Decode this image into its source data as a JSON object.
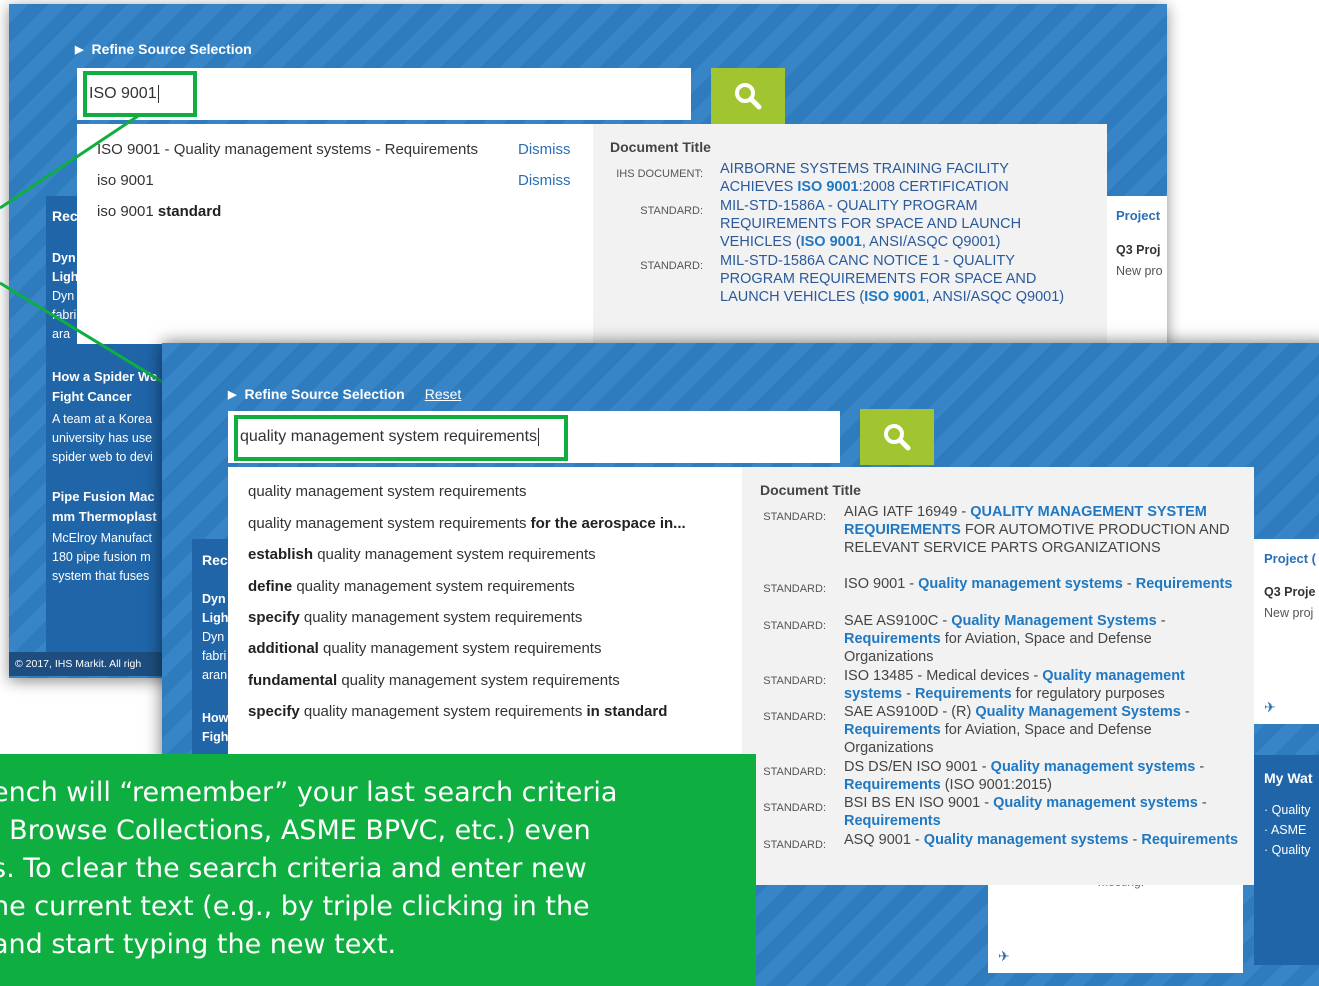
{
  "panel1": {
    "refine_label": "Refine Source Selection",
    "search_value": "ISO 9001",
    "suggestions": [
      {
        "text": "ISO 9001 - Quality management systems - Requirements",
        "dismiss": "Dismiss"
      },
      {
        "text": "iso 9001",
        "dismiss": "Dismiss"
      },
      {
        "prefix": "iso 9001 ",
        "bold": "standard"
      }
    ],
    "doc_header": "Document Title",
    "documents": [
      {
        "type": "IHS DOCUMENT:",
        "pre": "AIRBORNE SYSTEMS TRAINING FACILITY ACHIEVES ",
        "match": "ISO 9001",
        "post": ":2008 CERTIFICATION"
      },
      {
        "type": "STANDARD:",
        "pre": "MIL-STD-1586A - QUALITY PROGRAM REQUIREMENTS FOR SPACE AND LAUNCH VEHICLES (",
        "match": "ISO 9001",
        "post": ", ANSI/ASQC Q9001)"
      },
      {
        "type": "STANDARD:",
        "pre": "MIL-STD-1586A CANC NOTICE 1 - QUALITY PROGRAM REQUIREMENTS FOR SPACE AND LAUNCH VEHICLES (",
        "match": "ISO 9001",
        "post": ", ANSI/ASQC Q9001)"
      }
    ],
    "side_card": {
      "project": "Project",
      "q3": "Q3 Proj",
      "new": "New pro"
    },
    "bg": {
      "rec": "Rec",
      "dyn_lines": [
        "Dyn",
        "Ligh",
        "Dyn",
        "fabri",
        "ara"
      ],
      "spider_title": "How a Spider We Fight Cancer",
      "spider_body": "A team at a Korea university has use spider web to devi",
      "pipe_title": "Pipe Fusion Mac mm Thermoplast",
      "pipe_body": "McElroy Manufact 180 pipe fusion m system that fuses",
      "copyright": "© 2017, IHS Markit. All righ"
    }
  },
  "panel2": {
    "refine_label": "Refine Source Selection",
    "reset_label": "Reset",
    "search_value": "quality management system requirements",
    "suggestions": [
      {
        "pre": "",
        "bold_pre": "",
        "text": "quality management system requirements",
        "bold_post": ""
      },
      {
        "bold_pre": "",
        "text": "quality management system requirements ",
        "bold_post": "for the aerospace in..."
      },
      {
        "bold_pre": "establish ",
        "text": "quality management system requirements",
        "bold_post": ""
      },
      {
        "bold_pre": "define ",
        "text": "quality management system requirements",
        "bold_post": ""
      },
      {
        "bold_pre": "specify ",
        "text": "quality management system requirements",
        "bold_post": ""
      },
      {
        "bold_pre": "additional ",
        "text": "quality management system requirements",
        "bold_post": ""
      },
      {
        "bold_pre": "fundamental ",
        "text": "quality management system requirements",
        "bold_post": ""
      },
      {
        "bold_pre": "specify ",
        "text": "quality management system requirements ",
        "bold_post": "in standard"
      }
    ],
    "doc_header": "Document Title",
    "documents": [
      {
        "type": "STANDARD:",
        "parts": [
          [
            "AIAG IATF 16949 - ",
            0
          ],
          [
            "QUALITY MANAGEMENT SYSTEM REQUIREMENTS",
            1
          ],
          [
            " FOR AUTOMOTIVE PRODUCTION AND RELEVANT SERVICE PARTS ORGANIZATIONS",
            0
          ]
        ]
      },
      {
        "type": "STANDARD:",
        "parts": [
          [
            "ISO 9001 - ",
            0
          ],
          [
            "Quality management systems",
            1
          ],
          [
            " - ",
            0
          ],
          [
            "Requirements",
            1
          ]
        ]
      },
      {
        "type": "STANDARD:",
        "parts": [
          [
            "SAE AS9100C - ",
            0
          ],
          [
            "Quality Management Systems",
            1
          ],
          [
            " - ",
            0
          ],
          [
            "Requirements",
            1
          ],
          [
            " for Aviation, Space and Defense Organizations",
            0
          ]
        ]
      },
      {
        "type": "STANDARD:",
        "parts": [
          [
            "ISO 13485 - Medical devices - ",
            0
          ],
          [
            "Quality management systems",
            1
          ],
          [
            " - ",
            0
          ],
          [
            "Requirements",
            1
          ],
          [
            " for regulatory purposes",
            0
          ]
        ]
      },
      {
        "type": "STANDARD:",
        "parts": [
          [
            "SAE AS9100D - (R) ",
            0
          ],
          [
            "Quality Management Systems",
            1
          ],
          [
            " - ",
            0
          ],
          [
            "Requirements",
            1
          ],
          [
            " for Aviation, Space and Defense Organizations",
            0
          ]
        ]
      },
      {
        "type": "STANDARD:",
        "parts": [
          [
            "DS DS/EN ISO 9001 - ",
            0
          ],
          [
            "Quality management systems",
            1
          ],
          [
            " - ",
            0
          ],
          [
            "Requirements",
            1
          ],
          [
            " (ISO 9001:2015)",
            0
          ]
        ]
      },
      {
        "type": "STANDARD:",
        "parts": [
          [
            "BSI BS EN ISO 9001 - ",
            0
          ],
          [
            "Quality management systems",
            1
          ],
          [
            " - ",
            0
          ],
          [
            "Requirements",
            1
          ]
        ]
      },
      {
        "type": "STANDARD:",
        "parts": [
          [
            "ASQ 9001 - ",
            0
          ],
          [
            "Quality management systems",
            1
          ],
          [
            " - ",
            0
          ],
          [
            "Requirements",
            1
          ]
        ]
      }
    ],
    "side_card": {
      "project": "Project (",
      "q3": "Q3 Proje",
      "new": "New proj"
    },
    "watch": {
      "title": "My Wat",
      "items": [
        "Quality",
        "ASME",
        "Quality"
      ]
    },
    "bg": {
      "rec": "Rec",
      "dyn_lines": [
        "Dyn",
        "Ligh",
        "Dyn",
        "fabri",
        "aran"
      ],
      "how": "How",
      "fig": "Figh",
      "meeting": "meeting."
    }
  },
  "callout_lines": [
    "ench will “remember” your last search criteria",
    ", Browse Collections, ASME BPVC, etc.) even",
    "s. To clear the search criteria and enter new",
    "he current text (e.g., by triple clicking in the",
    " and start typing the new text."
  ],
  "colors": {
    "highlight": "#0fae41",
    "panel_blue": "#2f7fc4",
    "search_button": "#a0c531",
    "link": "#2a6fb5"
  }
}
